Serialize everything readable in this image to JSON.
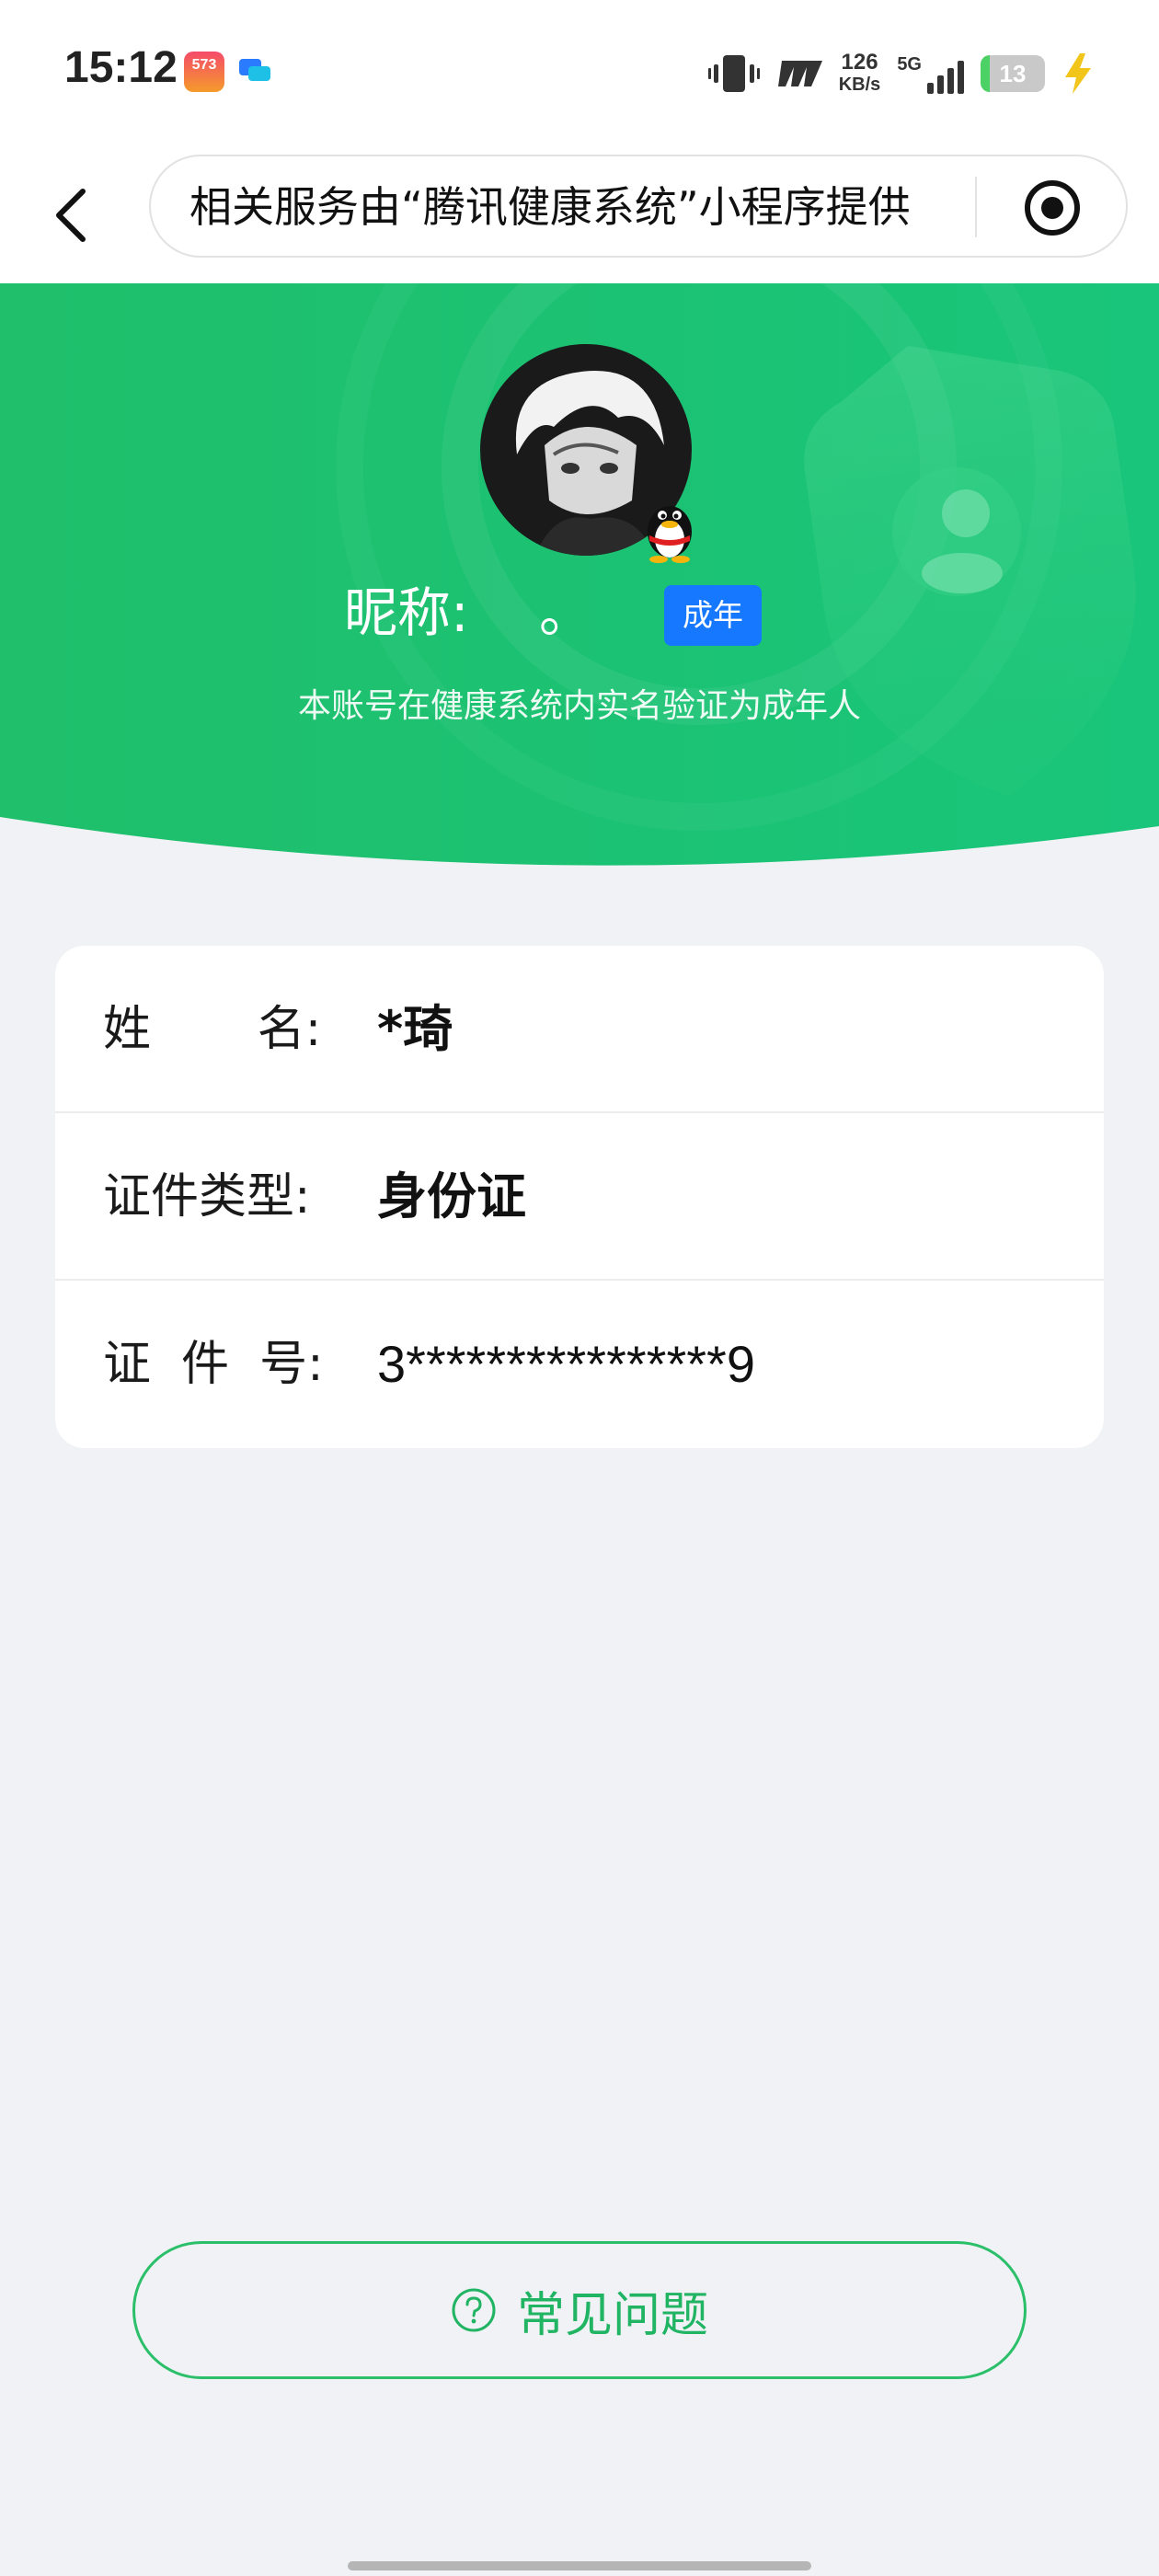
{
  "status_bar": {
    "time": "15:12",
    "app1_badge": "573",
    "net_speed_value": "126",
    "net_speed_unit": "KB/s",
    "network_type": "5G",
    "battery_level": "13",
    "signal_bars": 4
  },
  "nav": {
    "title": "相关服务由“腾讯健康系统”小程序提供"
  },
  "profile": {
    "nickname_label": "昵称:",
    "nickname_value": "。",
    "adult_badge": "成年",
    "description": "本账号在健康系统内实名验证为成年人"
  },
  "info": {
    "rows": [
      {
        "label": "姓       名:",
        "value": "*琦"
      },
      {
        "label": "证件类型:",
        "value": "身份证"
      },
      {
        "label": "证  件  号:",
        "value": "3****************9"
      }
    ]
  },
  "faq": {
    "label": "常见问题"
  },
  "colors": {
    "brand_green": "#20c06a",
    "badge_blue": "#1677ff",
    "page_bg": "#f0f2f5"
  }
}
